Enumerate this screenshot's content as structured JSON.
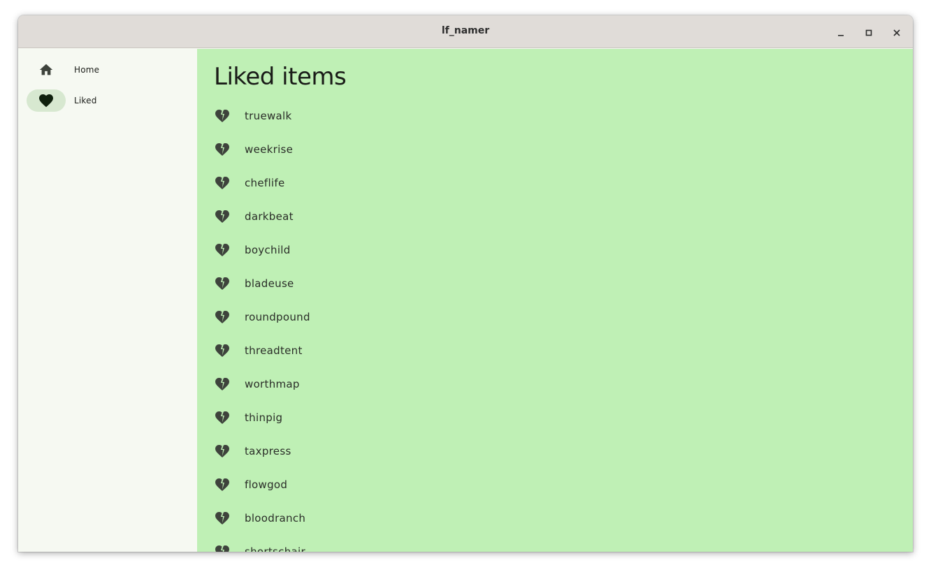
{
  "window": {
    "title": "lf_namer",
    "controls": {
      "minimize": "minimize-icon",
      "maximize": "maximize-icon",
      "close": "close-icon"
    }
  },
  "sidebar": {
    "items": [
      {
        "label": "Home",
        "icon": "home-icon",
        "selected": false
      },
      {
        "label": "Liked",
        "icon": "heart-icon",
        "selected": true
      }
    ]
  },
  "main": {
    "title": "Liked items",
    "item_icon": "broken-heart-icon",
    "items": [
      "truewalk",
      "weekrise",
      "cheflife",
      "darkbeat",
      "boychild",
      "bladeuse",
      "roundpound",
      "threadtent",
      "worthmap",
      "thinpig",
      "taxpress",
      "flowgod",
      "bloodranch",
      "shortschair"
    ]
  },
  "colors": {
    "titlebar": "#e0dcd8",
    "sidebar_bg": "#f6f9f2",
    "selected_indicator": "#d7e8d0",
    "main_bg": "#bff0b5",
    "icon": "#3e433c"
  }
}
